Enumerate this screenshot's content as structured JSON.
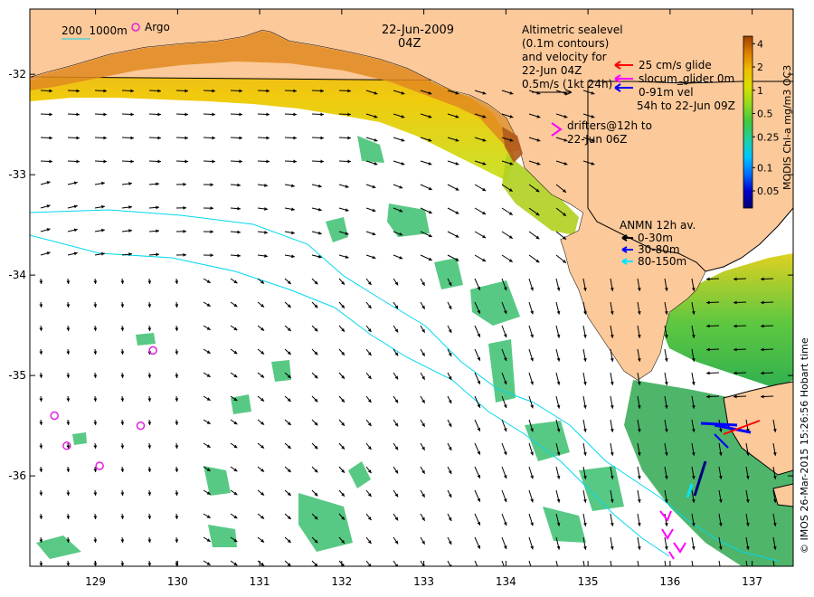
{
  "figure": {
    "date_text": "22-Jun-2009",
    "time_text": "04Z",
    "scale_text": "200  1000m",
    "argo_label": "Argo",
    "credit_text": "© IMOS 26-Mar-2015 15:26:56 Hobart time",
    "altimetry_note": [
      "Altimetric sealevel",
      "(0.1m contours)",
      "and velocity for",
      "22-Jun 04Z",
      "0.5m/s (1kt 24h)"
    ],
    "glider_legend": [
      {
        "text": "25 cm/s glide",
        "color": "#ff0000"
      },
      {
        "text": "slocum_glider 0m",
        "color": "#ff00ff"
      },
      {
        "text": "0-91m vel",
        "color": "#0000ff"
      },
      {
        "text": "54h to 22-Jun 09Z",
        "color": ""
      }
    ],
    "drifters_note": [
      "drifters@12h to",
      "22-Jun 06Z"
    ],
    "anmn_title": "ANMN 12h av.",
    "anmn_legend": [
      {
        "text": "0-30m",
        "color": "#000000"
      },
      {
        "text": "30-80m",
        "color": "#0000ff"
      },
      {
        "text": "80-150m",
        "color": "#00e5ff"
      }
    ]
  },
  "axes": {
    "lon_ticks": [
      129,
      130,
      131,
      132,
      133,
      134,
      135,
      136,
      137
    ],
    "lat_ticks": [
      -32,
      -33,
      -34,
      -35,
      -36
    ],
    "lon_range": [
      128.2,
      137.5
    ],
    "lat_range": [
      -36.9,
      -31.35
    ]
  },
  "colorbar": {
    "label": "MODIS Chl-a mg/m3 OC3",
    "tick_labels": [
      "4",
      "2",
      "1",
      "0.5",
      "0.25",
      "0.1",
      "0.05"
    ],
    "tick_values": [
      4,
      2,
      1,
      0.5,
      0.25,
      0.1,
      0.05
    ],
    "range": [
      0.03,
      5
    ],
    "colors": [
      "#00006e",
      "#0000cc",
      "#0070ff",
      "#00c8ff",
      "#20d0a0",
      "#40c840",
      "#90d820",
      "#d8e000",
      "#f0c000",
      "#e08000",
      "#a04000"
    ]
  },
  "colors": {
    "land": "#fcc99a",
    "sea_background": "#ffffff",
    "coast": "#000000",
    "bathy_contour": "#00d8f0",
    "argo_marker": "#e020e0",
    "drifter_marker": "#ff00ff"
  },
  "argo_floats": [
    {
      "lon": 129.7,
      "lat": -34.75
    },
    {
      "lon": 128.5,
      "lat": -35.4
    },
    {
      "lon": 129.55,
      "lat": -35.5
    },
    {
      "lon": 128.65,
      "lat": -35.7
    },
    {
      "lon": 129.05,
      "lat": -35.9
    }
  ]
}
